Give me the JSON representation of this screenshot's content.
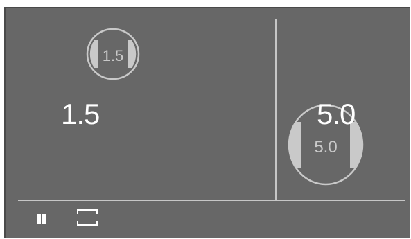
{
  "left_panel": {
    "value_label": "1.5",
    "dial_label": "1.5"
  },
  "right_panel": {
    "value_label": "5.0",
    "dial_label": "5.0"
  },
  "controls": {
    "play_pause_icon": "pause-icon",
    "fullscreen_icon": "fullscreen-icon"
  },
  "colors": {
    "background": "#676767",
    "divider": "#c6c6c6",
    "dial": "#c9c9c9",
    "text": "#ffffff"
  }
}
